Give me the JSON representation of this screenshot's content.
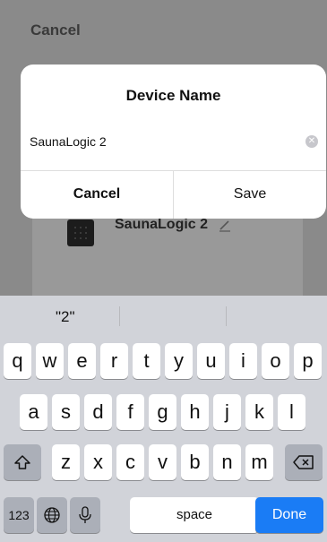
{
  "background": {
    "cancel_label": "Cancel",
    "device_name": "SaunaLogic 2"
  },
  "dialog": {
    "title": "Device Name",
    "input_value": "SaunaLogic 2",
    "cancel_label": "Cancel",
    "save_label": "Save"
  },
  "keyboard": {
    "suggestion": "\"2\"",
    "row1": [
      "q",
      "w",
      "e",
      "r",
      "t",
      "y",
      "u",
      "i",
      "o",
      "p"
    ],
    "row2": [
      "a",
      "s",
      "d",
      "f",
      "g",
      "h",
      "j",
      "k",
      "l"
    ],
    "row3": [
      "z",
      "x",
      "c",
      "v",
      "b",
      "n",
      "m"
    ],
    "numbers_label": "123",
    "space_label": "space",
    "done_label": "Done"
  },
  "colors": {
    "done_key": "#1a7cf5"
  }
}
